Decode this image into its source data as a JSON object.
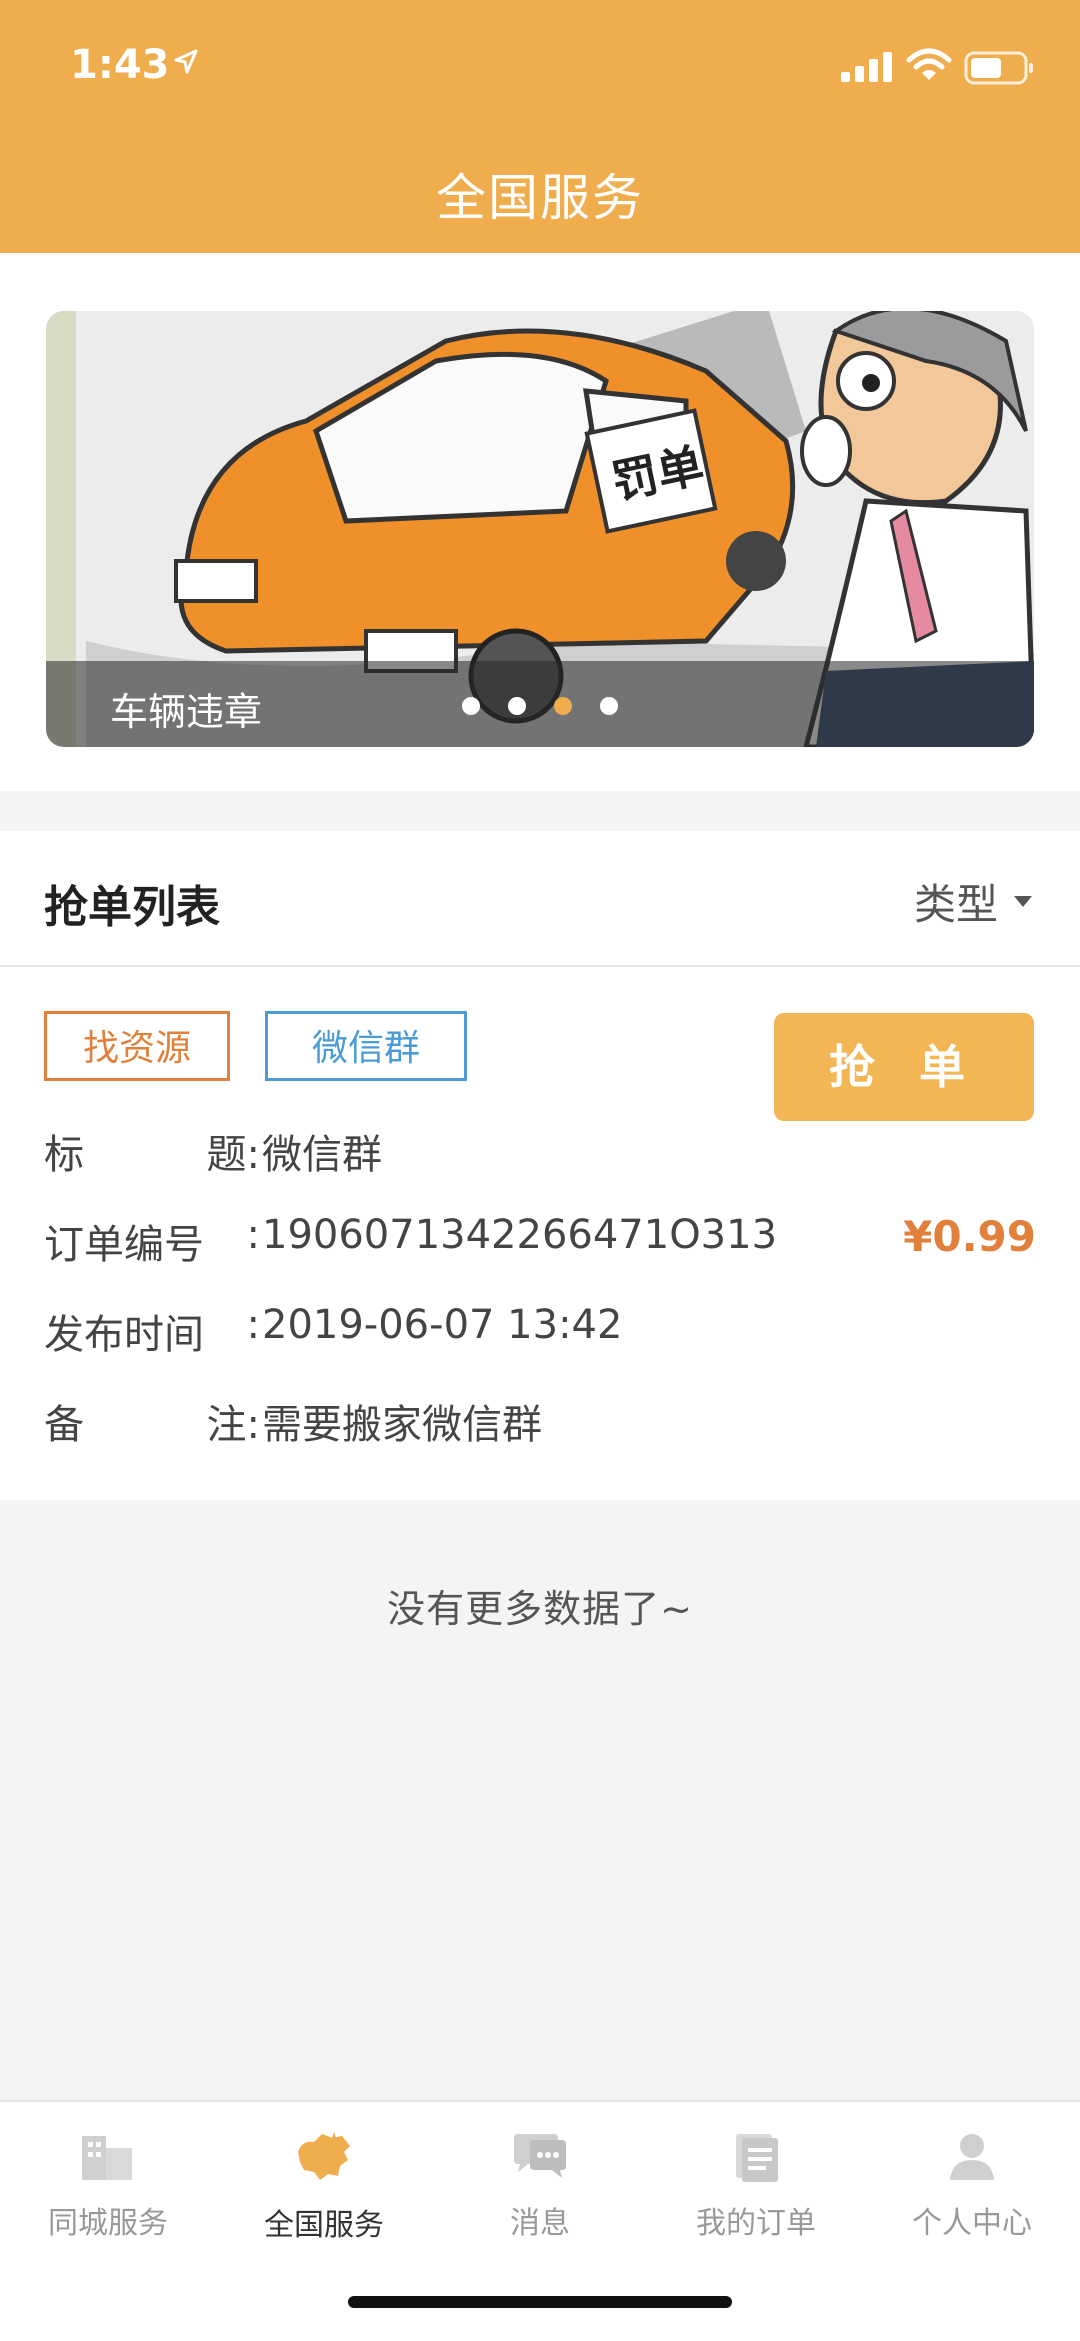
{
  "status": {
    "time": "1:43"
  },
  "header": {
    "title": "全国服务"
  },
  "banner": {
    "caption": "车辆违章",
    "dots": 4,
    "active_dot": 3
  },
  "list": {
    "title": "抢单列表",
    "filter_label": "类型"
  },
  "order": {
    "tags": [
      "找资源",
      "微信群"
    ],
    "grab_label": "抢 单",
    "fields": [
      {
        "label_a": "标",
        "label_b": "题:",
        "value": "微信群"
      },
      {
        "label_a": "订单编号",
        "label_b": ":",
        "value": "1906071342266471O313"
      },
      {
        "label_a": "发布时间",
        "label_b": ":",
        "value": "2019-06-07 13:42"
      },
      {
        "label_a": "备",
        "label_b": "注:",
        "value": "需要搬家微信群"
      }
    ],
    "price": "¥0.99"
  },
  "footer_text": "没有更多数据了~",
  "tabs": [
    {
      "label": "同城服务",
      "icon": "city-buildings-icon",
      "active": false
    },
    {
      "label": "全国服务",
      "icon": "china-map-icon",
      "active": true
    },
    {
      "label": "消息",
      "icon": "message-icon",
      "active": false
    },
    {
      "label": "我的订单",
      "icon": "orders-icon",
      "active": false
    },
    {
      "label": "个人中心",
      "icon": "user-icon",
      "active": false
    }
  ],
  "colors": {
    "accent": "#efad4d",
    "orange": "#e0803a",
    "blue": "#4a9bd6"
  }
}
